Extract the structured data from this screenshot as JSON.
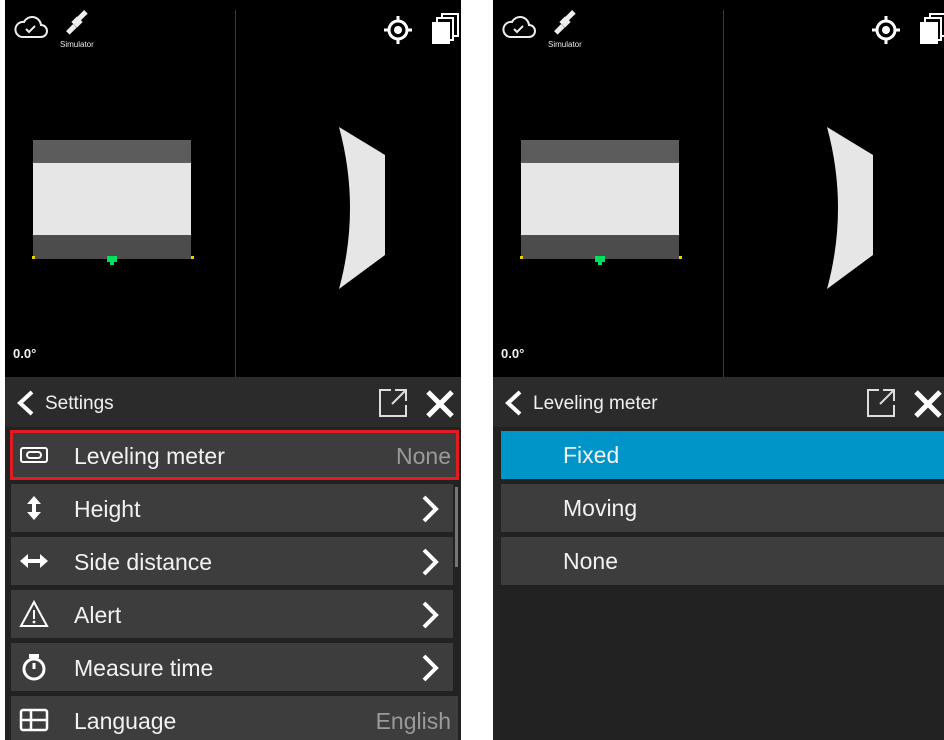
{
  "left": {
    "status": {
      "simulator_label": "Simulator"
    },
    "viewport": {
      "angle": "0.0°"
    },
    "panel": {
      "title": "Settings",
      "rows": [
        {
          "icon": "leveling-meter-icon",
          "label": "Leveling meter",
          "value": "None",
          "highlighted": true
        },
        {
          "icon": "height-arrow-icon",
          "label": "Height",
          "value": ""
        },
        {
          "icon": "side-distance-arrow-icon",
          "label": "Side distance",
          "value": ""
        },
        {
          "icon": "alert-triangle-icon",
          "label": "Alert",
          "value": ""
        },
        {
          "icon": "stopwatch-icon",
          "label": "Measure time",
          "value": ""
        },
        {
          "icon": "language-table-icon",
          "label": "Language",
          "value": "English"
        }
      ]
    }
  },
  "right": {
    "status": {
      "simulator_label": "Simulator"
    },
    "viewport": {
      "angle": "0.0°"
    },
    "panel": {
      "title": "Leveling meter",
      "options": [
        {
          "label": "Fixed",
          "selected": true
        },
        {
          "label": "Moving",
          "selected": false
        },
        {
          "label": "None",
          "selected": false
        }
      ]
    }
  },
  "colors": {
    "viewport_bg": "#000000",
    "panel_bg": "#222222",
    "row_bg": "#3d3d3d",
    "selected_accent": "#0095c8",
    "highlight_border": "#e01b22",
    "marker_green": "#00e060",
    "marker_yellow": "#e8d300"
  }
}
